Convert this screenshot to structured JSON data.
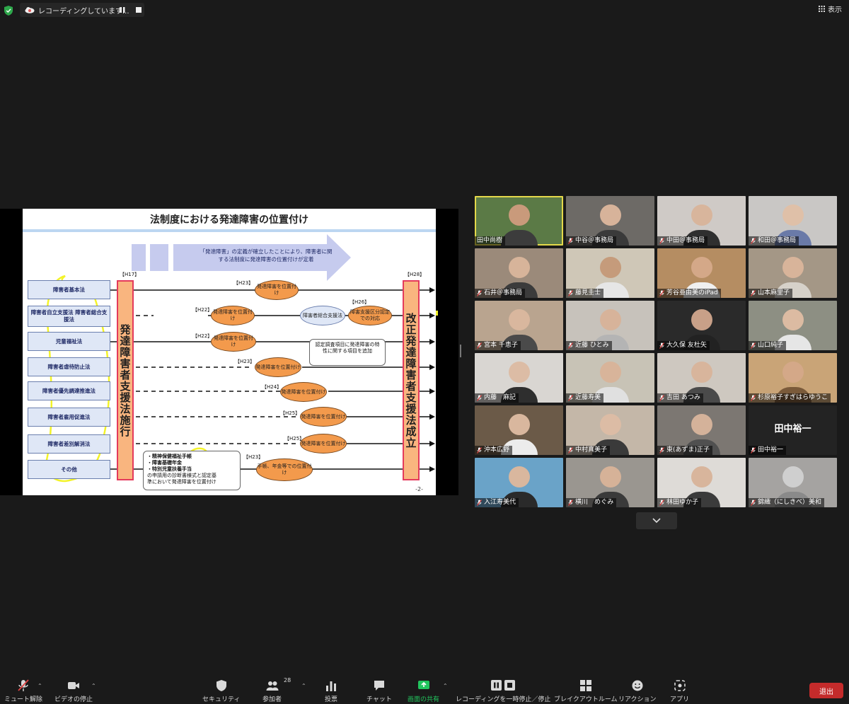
{
  "recording": {
    "text": "レコーディングしています...",
    "status_color": "#e15a5a"
  },
  "view_button": {
    "label": "表示"
  },
  "slide": {
    "title": "法制度における発達障害の位置付け",
    "banner": "「発達障害」の定義が確立したことにより、障害者に関する法制度に発達障害の位置付けが定着",
    "h17": "【H17】",
    "h28": "【H28】",
    "left_bar": "発達障害者支援法施行",
    "right_bar": "改正発達障害者支援法成立",
    "laws": [
      "障害者基本法",
      "障害者自立支援法 障害者総合支援法",
      "児童福祉法",
      "障害者虐待防止法",
      "障害者優先調達推進法",
      "障害者雇用促進法",
      "障害者差別解消法",
      "その他"
    ],
    "pills": [
      {
        "year": "【H23】",
        "text": "発達障害を位置付け"
      },
      {
        "year": "【H22】",
        "text": "発達障害を位置付け"
      },
      {
        "year": "",
        "text": "障害者総合支援法"
      },
      {
        "year": "【H26】",
        "text": "障害支援区分認定での対応"
      },
      {
        "year": "【H22】",
        "text": "発達障害を位置付け"
      },
      {
        "year": "【H23】",
        "text": "発達障害を位置付け"
      },
      {
        "year": "【H24】",
        "text": "発達障害を位置付け"
      },
      {
        "year": "【H25】",
        "text": "発達障害を位置付け"
      },
      {
        "year": "【H25】",
        "text": "発達障害を位置付け"
      },
      {
        "year": "【H23】",
        "text": "手帳、年金等での位置付け"
      }
    ],
    "callout_h26": "認定調査項目に発達障害の特性に関する項目を追加",
    "callout_other": [
      "・精神保健福祉手帳",
      "・障害基礎年金",
      "・特別児童扶養手当",
      "の申請用の診断書様式と認定基",
      "準において発達障害を位置付け"
    ],
    "page": "-2-"
  },
  "participants": [
    {
      "name": "田中尚樹",
      "muted": false,
      "bg": "#5b7a46",
      "skin": "#c99a7b",
      "shirt": "#3c3c3c",
      "speaking": true
    },
    {
      "name": "中谷＠事務局",
      "muted": true,
      "bg": "#6d6a66",
      "skin": "#d7b39a",
      "shirt": "#3a3a3a"
    },
    {
      "name": "中田＠事務局",
      "muted": true,
      "bg": "#cfcac6",
      "skin": "#d8b59c",
      "shirt": "#2f2f2f"
    },
    {
      "name": "和田＠事務局",
      "muted": true,
      "bg": "#c9c7c5",
      "skin": "#dfc0a8",
      "shirt": "#6a7aa8"
    },
    {
      "name": "石井＠事務局",
      "muted": true,
      "bg": "#9b8a7a",
      "skin": "#d7b49a",
      "shirt": "#3b3b3b"
    },
    {
      "name": "藤見圭士",
      "muted": true,
      "bg": "#cfc7b7",
      "skin": "#c59b7b",
      "shirt": "#e6e6e6"
    },
    {
      "name": "芳谷亜由美のiPad",
      "muted": true,
      "bg": "#b58d62",
      "skin": "#d4a888",
      "shirt": "#f0f0f0"
    },
    {
      "name": "山本麻里子",
      "muted": true,
      "bg": "#a49786",
      "skin": "#d8b49a",
      "shirt": "#d6d1c9"
    },
    {
      "name": "宮本 千恵子",
      "muted": true,
      "bg": "#b9a48f",
      "skin": "#d9b79e",
      "shirt": "#4a4a4a"
    },
    {
      "name": "近藤 ひとみ",
      "muted": true,
      "bg": "#c7c2bb",
      "skin": "#d7b39a",
      "shirt": "#b4b4b4"
    },
    {
      "name": "大久保 友杜矢",
      "muted": true,
      "bg": "#2a2a2a",
      "skin": "#c8a088",
      "shirt": "#222222"
    },
    {
      "name": "山口純子",
      "muted": true,
      "bg": "#8d8f83",
      "skin": "#dcbba2",
      "shirt": "#e6e6e6"
    },
    {
      "name": "内藤　麻記",
      "muted": true,
      "bg": "#d9d6d2",
      "skin": "#dcbca5",
      "shirt": "#2e2e2e"
    },
    {
      "name": "近藤寿美",
      "muted": true,
      "bg": "#c8c3b6",
      "skin": "#d8b49a",
      "shirt": "#e0e0e0"
    },
    {
      "name": "吉田 あつみ",
      "muted": true,
      "bg": "#cec8c0",
      "skin": "#d8b59c",
      "shirt": "#4a4a4a"
    },
    {
      "name": "杉原裕子すぎはらゆうこ",
      "muted": true,
      "bg": "#c9a477",
      "skin": "#d4a888",
      "shirt": "#7a5a3a"
    },
    {
      "name": "沖本広野",
      "muted": true,
      "bg": "#6b5a48",
      "skin": "#d9b79e",
      "shirt": "#ececec"
    },
    {
      "name": "中村真美子",
      "muted": true,
      "bg": "#c4b7a8",
      "skin": "#dcbca5",
      "shirt": "#3a3a3a"
    },
    {
      "name": "東(あずま)正子",
      "muted": true,
      "bg": "#7c7772",
      "skin": "#d4b29a",
      "shirt": "#505050"
    },
    {
      "name": "田中裕一",
      "muted": true,
      "text_only": true
    },
    {
      "name": "入江寿美代",
      "muted": true,
      "bg": "#6aa3c8",
      "skin": "#d9b79e",
      "shirt": "#2a2a2a"
    },
    {
      "name": "横川　めぐみ",
      "muted": true,
      "bg": "#9a9690",
      "skin": "#d6b298",
      "shirt": "#3a3a3a"
    },
    {
      "name": "林田ゆか子",
      "muted": true,
      "bg": "#dedbd7",
      "skin": "#d8b59c",
      "shirt": "#3b3b3b"
    },
    {
      "name": "錦織（にしきべ）美和",
      "muted": true,
      "bg": "#a5a3a1",
      "skin": "#cfcfcf",
      "shirt": "#8a8a8a"
    }
  ],
  "toolbar": {
    "unmute": "ミュート解除",
    "video": "ビデオの停止",
    "security": "セキュリティ",
    "participants": "参加者",
    "participants_count": "28",
    "polls": "投票",
    "chat": "チャット",
    "share": "画面の共有",
    "recording": "レコーディングを一時停止／停止",
    "breakout": "ブレイクアウトルーム",
    "reactions": "リアクション",
    "apps": "アプリ",
    "leave": "退出",
    "share_color": "#22c55e",
    "leave_color": "#c42b2b"
  }
}
